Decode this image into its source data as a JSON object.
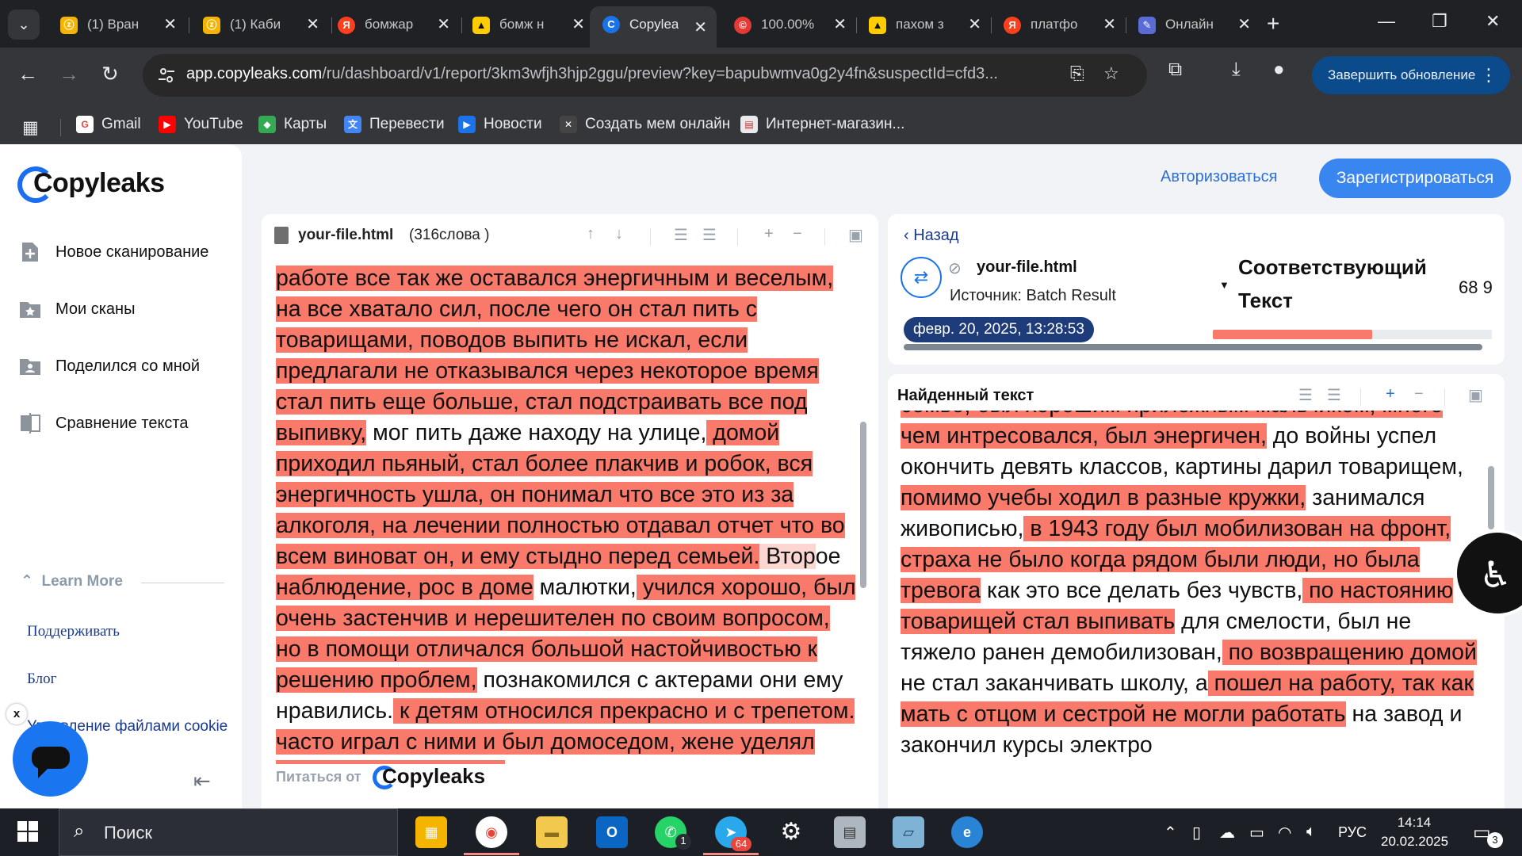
{
  "browser": {
    "tabs": [
      {
        "title": "(1) Вран",
        "icon": "yellow-app-icon",
        "color": "#f4b400"
      },
      {
        "title": "(1) Каби",
        "icon": "yellow-app-icon",
        "color": "#f4b400"
      },
      {
        "title": "бомжар",
        "icon": "yandex-icon",
        "color": "#fc3f1d"
      },
      {
        "title": "бомж н",
        "icon": "image-icon",
        "color": "#ffcc00"
      },
      {
        "title": "Copylea",
        "icon": "copyleaks-icon",
        "color": "#1a73e8"
      },
      {
        "title": "100.00%",
        "icon": "copyright-icon",
        "color": "#e53935"
      },
      {
        "title": "пахом з",
        "icon": "image-icon",
        "color": "#ffcc00"
      },
      {
        "title": "платфо",
        "icon": "yandex-icon",
        "color": "#fc3f1d"
      },
      {
        "title": "Онлайн",
        "icon": "brush-icon",
        "color": "#5b6bd6"
      }
    ],
    "url_domain": "app.copyleaks.com",
    "url_path": "/ru/dashboard/v1/report/3km3wfjh3hjp2ggu/preview?key=bapubwmva0g2y4fn&suspectId=cfd3...",
    "update_button": "Завершить обновление",
    "bookmarks": [
      {
        "label": "Gmail",
        "icon": "gmail-icon",
        "color": "#ea4335",
        "glyph": "G"
      },
      {
        "label": "YouTube",
        "icon": "youtube-icon",
        "color": "#ff0000",
        "glyph": "▶"
      },
      {
        "label": "Карты",
        "icon": "maps-icon",
        "color": "#34a853",
        "glyph": "◆"
      },
      {
        "label": "Перевести",
        "icon": "translate-icon",
        "color": "#4285f4",
        "glyph": "文"
      },
      {
        "label": "Новости",
        "icon": "news-icon",
        "color": "#1a73e8",
        "glyph": "▶"
      },
      {
        "label": "Создать мем онлайн",
        "icon": "meme-icon",
        "color": "#444444",
        "glyph": "✕"
      },
      {
        "label": "Интернет-магазин...",
        "icon": "store-icon",
        "color": "#e8eaed",
        "glyph": "▤"
      }
    ]
  },
  "sidebar": {
    "logo": "Copyleaks",
    "items": [
      {
        "label": "Новое сканирование",
        "icon": "new-scan-icon"
      },
      {
        "label": "Мои сканы",
        "icon": "folder-star-icon"
      },
      {
        "label": "Поделился со мной",
        "icon": "shared-folder-icon"
      },
      {
        "label": "Сравнение текста",
        "icon": "compare-icon"
      }
    ],
    "learn_more": "Learn More",
    "links": [
      "Поддерживать",
      "Блог",
      "Управление файлами cookie"
    ]
  },
  "header": {
    "login": "Авторизоваться",
    "register": "Зарегистрироваться"
  },
  "document": {
    "filename": "your-file.html",
    "word_count": "(316слова )",
    "powered_by": "Питаться от",
    "powered_logo": "Copyleaks"
  },
  "match": {
    "back": "Назад",
    "filename": "your-file.html",
    "source": "Источник: Batch Result",
    "date": "февр. 20, 2025, 13:28:53",
    "title": "Соответствующий Текст",
    "percent": "68 9",
    "match_fraction": 0.57,
    "found_title": "Найденный текст"
  },
  "colors": {
    "highlight": "#f97a6a",
    "brand": "#1c6ef0",
    "update_button": "#0b4a8b"
  },
  "taskbar": {
    "search": "Поиск",
    "lang": "РУС",
    "time": "14:14",
    "date": "20.02.2025",
    "whatsapp_badge": "1",
    "telegram_badge": "64",
    "notifications": "3"
  }
}
